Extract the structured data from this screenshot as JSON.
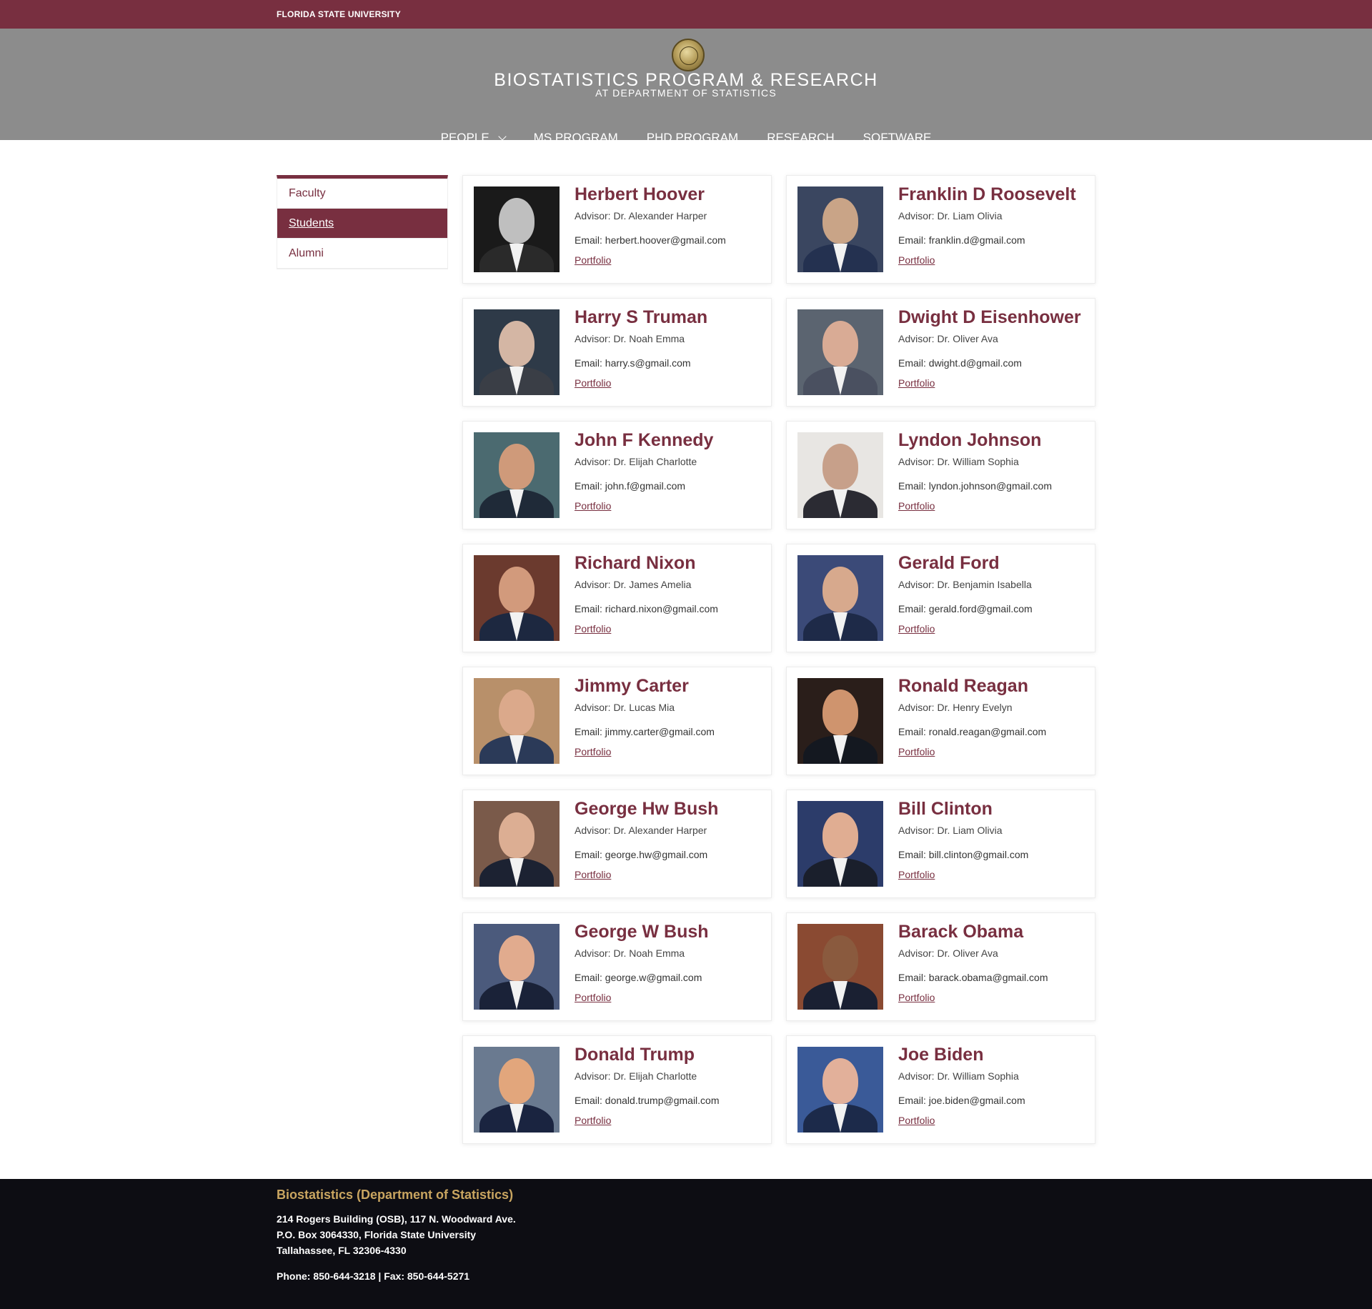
{
  "topbar": {
    "university": "FLORIDA STATE UNIVERSITY"
  },
  "header": {
    "title": "BIOSTATISTICS PROGRAM & RESEARCH",
    "subtitle": "AT DEPARTMENT OF STATISTICS",
    "nav": [
      {
        "label": "PEOPLE",
        "dropdown": true
      },
      {
        "label": "MS PROGRAM"
      },
      {
        "label": "PHD PROGRAM"
      },
      {
        "label": "RESEARCH"
      },
      {
        "label": "SOFTWARE"
      }
    ]
  },
  "sidebar": {
    "items": [
      {
        "label": "Faculty",
        "active": false
      },
      {
        "label": "Students",
        "active": true
      },
      {
        "label": "Alumni",
        "active": false
      }
    ]
  },
  "students": [
    {
      "name": "Herbert Hoover",
      "advisor": "Advisor: Dr. Alexander Harper",
      "email": "Email:  herbert.hoover@gmail.com",
      "link": "Portfolio",
      "bg": "#1a1a1a",
      "skin": "#bfbfbf",
      "suit": "#2a2a2a"
    },
    {
      "name": "Franklin D Roosevelt",
      "advisor": "Advisor: Dr. Liam Olivia",
      "email": "Email:  franklin.d@gmail.com",
      "link": "Portfolio",
      "bg": "#3a4660",
      "skin": "#c9a487",
      "suit": "#243150"
    },
    {
      "name": "Harry S Truman",
      "advisor": "Advisor: Dr. Noah Emma",
      "email": "Email:  harry.s@gmail.com",
      "link": "Portfolio",
      "bg": "#2e3a48",
      "skin": "#d4b6a4",
      "suit": "#3a3e46"
    },
    {
      "name": "Dwight D Eisenhower",
      "advisor": "Advisor: Dr. Oliver Ava",
      "email": "Email:  dwight.d@gmail.com",
      "link": "Portfolio",
      "bg": "#5b6470",
      "skin": "#d9ab95",
      "suit": "#4a5060"
    },
    {
      "name": "John F Kennedy",
      "advisor": "Advisor: Dr. Elijah Charlotte",
      "email": "Email:  john.f@gmail.com",
      "link": "Portfolio",
      "bg": "#4b6a70",
      "skin": "#cf9a7a",
      "suit": "#1f2a38"
    },
    {
      "name": "Lyndon Johnson",
      "advisor": "Advisor: Dr. William Sophia",
      "email": "Email:  lyndon.johnson@gmail.com",
      "link": "Portfolio",
      "bg": "#e8e6e3",
      "skin": "#c7a08a",
      "suit": "#2b2b33"
    },
    {
      "name": "Richard Nixon",
      "advisor": "Advisor: Dr. James Amelia",
      "email": "Email:  richard.nixon@gmail.com",
      "link": "Portfolio",
      "bg": "#6b3a2e",
      "skin": "#d29a7c",
      "suit": "#1d2840"
    },
    {
      "name": "Gerald Ford",
      "advisor": "Advisor: Dr. Benjamin Isabella",
      "email": "Email:  gerald.ford@gmail.com",
      "link": "Portfolio",
      "bg": "#3b4a78",
      "skin": "#d7a98d",
      "suit": "#1e2a48"
    },
    {
      "name": "Jimmy Carter",
      "advisor": "Advisor: Dr. Lucas Mia",
      "email": "Email:  jimmy.carter@gmail.com",
      "link": "Portfolio",
      "bg": "#b8906a",
      "skin": "#dba98b",
      "suit": "#2b3a58"
    },
    {
      "name": "Ronald Reagan",
      "advisor": "Advisor: Dr. Henry Evelyn",
      "email": "Email:  ronald.reagan@gmail.com",
      "link": "Portfolio",
      "bg": "#2a1e1a",
      "skin": "#cf946e",
      "suit": "#141820"
    },
    {
      "name": "George Hw Bush",
      "advisor": "Advisor: Dr. Alexander Harper",
      "email": "Email:  george.hw@gmail.com",
      "link": "Portfolio",
      "bg": "#7a5a4a",
      "skin": "#dcae93",
      "suit": "#1c2232"
    },
    {
      "name": "Bill Clinton",
      "advisor": "Advisor: Dr. Liam Olivia",
      "email": "Email:  bill.clinton@gmail.com",
      "link": "Portfolio",
      "bg": "#2c3c6a",
      "skin": "#e0ad92",
      "suit": "#1a1f2c"
    },
    {
      "name": "George W Bush",
      "advisor": "Advisor: Dr. Noah Emma",
      "email": "Email:  george.w@gmail.com",
      "link": "Portfolio",
      "bg": "#4b5a7c",
      "skin": "#e1ab8e",
      "suit": "#1a2238"
    },
    {
      "name": "Barack Obama",
      "advisor": "Advisor: Dr. Oliver Ava",
      "email": "Email:  barack.obama@gmail.com",
      "link": "Portfolio",
      "bg": "#8a4a32",
      "skin": "#8a5a3e",
      "suit": "#1a2032"
    },
    {
      "name": "Donald Trump",
      "advisor": "Advisor: Dr. Elijah Charlotte",
      "email": "Email:  donald.trump@gmail.com",
      "link": "Portfolio",
      "bg": "#6a7a90",
      "skin": "#e2a67c",
      "suit": "#1a2440"
    },
    {
      "name": "Joe Biden",
      "advisor": "Advisor: Dr. William Sophia",
      "email": "Email:  joe.biden@gmail.com",
      "link": "Portfolio",
      "bg": "#3a5a98",
      "skin": "#e2b09a",
      "suit": "#1c2a4a"
    }
  ],
  "footer": {
    "title": "Biostatistics (Department of Statistics)",
    "address_line1": "214 Rogers Building (OSB), 117 N. Woodward Ave.",
    "address_line2": "P.O. Box 3064330, Florida State University",
    "address_line3": "Tallahassee, FL 32306-4330",
    "phone": "Phone: 850-644-3218 | Fax: 850-644-5271"
  },
  "colors": {
    "garnet": "#782f40",
    "header_gray": "#8c8c8c",
    "gold": "#c9a560",
    "footer_bg": "#0d0d13"
  }
}
